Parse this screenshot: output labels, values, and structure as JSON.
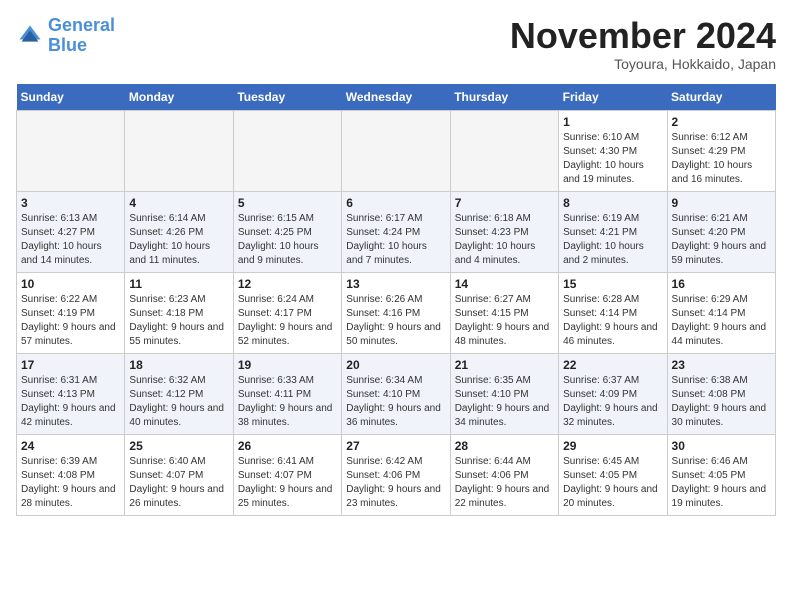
{
  "logo": {
    "line1": "General",
    "line2": "Blue"
  },
  "title": "November 2024",
  "subtitle": "Toyoura, Hokkaido, Japan",
  "weekdays": [
    "Sunday",
    "Monday",
    "Tuesday",
    "Wednesday",
    "Thursday",
    "Friday",
    "Saturday"
  ],
  "weeks": [
    [
      {
        "day": "",
        "info": ""
      },
      {
        "day": "",
        "info": ""
      },
      {
        "day": "",
        "info": ""
      },
      {
        "day": "",
        "info": ""
      },
      {
        "day": "",
        "info": ""
      },
      {
        "day": "1",
        "info": "Sunrise: 6:10 AM\nSunset: 4:30 PM\nDaylight: 10 hours and 19 minutes."
      },
      {
        "day": "2",
        "info": "Sunrise: 6:12 AM\nSunset: 4:29 PM\nDaylight: 10 hours and 16 minutes."
      }
    ],
    [
      {
        "day": "3",
        "info": "Sunrise: 6:13 AM\nSunset: 4:27 PM\nDaylight: 10 hours and 14 minutes."
      },
      {
        "day": "4",
        "info": "Sunrise: 6:14 AM\nSunset: 4:26 PM\nDaylight: 10 hours and 11 minutes."
      },
      {
        "day": "5",
        "info": "Sunrise: 6:15 AM\nSunset: 4:25 PM\nDaylight: 10 hours and 9 minutes."
      },
      {
        "day": "6",
        "info": "Sunrise: 6:17 AM\nSunset: 4:24 PM\nDaylight: 10 hours and 7 minutes."
      },
      {
        "day": "7",
        "info": "Sunrise: 6:18 AM\nSunset: 4:23 PM\nDaylight: 10 hours and 4 minutes."
      },
      {
        "day": "8",
        "info": "Sunrise: 6:19 AM\nSunset: 4:21 PM\nDaylight: 10 hours and 2 minutes."
      },
      {
        "day": "9",
        "info": "Sunrise: 6:21 AM\nSunset: 4:20 PM\nDaylight: 9 hours and 59 minutes."
      }
    ],
    [
      {
        "day": "10",
        "info": "Sunrise: 6:22 AM\nSunset: 4:19 PM\nDaylight: 9 hours and 57 minutes."
      },
      {
        "day": "11",
        "info": "Sunrise: 6:23 AM\nSunset: 4:18 PM\nDaylight: 9 hours and 55 minutes."
      },
      {
        "day": "12",
        "info": "Sunrise: 6:24 AM\nSunset: 4:17 PM\nDaylight: 9 hours and 52 minutes."
      },
      {
        "day": "13",
        "info": "Sunrise: 6:26 AM\nSunset: 4:16 PM\nDaylight: 9 hours and 50 minutes."
      },
      {
        "day": "14",
        "info": "Sunrise: 6:27 AM\nSunset: 4:15 PM\nDaylight: 9 hours and 48 minutes."
      },
      {
        "day": "15",
        "info": "Sunrise: 6:28 AM\nSunset: 4:14 PM\nDaylight: 9 hours and 46 minutes."
      },
      {
        "day": "16",
        "info": "Sunrise: 6:29 AM\nSunset: 4:14 PM\nDaylight: 9 hours and 44 minutes."
      }
    ],
    [
      {
        "day": "17",
        "info": "Sunrise: 6:31 AM\nSunset: 4:13 PM\nDaylight: 9 hours and 42 minutes."
      },
      {
        "day": "18",
        "info": "Sunrise: 6:32 AM\nSunset: 4:12 PM\nDaylight: 9 hours and 40 minutes."
      },
      {
        "day": "19",
        "info": "Sunrise: 6:33 AM\nSunset: 4:11 PM\nDaylight: 9 hours and 38 minutes."
      },
      {
        "day": "20",
        "info": "Sunrise: 6:34 AM\nSunset: 4:10 PM\nDaylight: 9 hours and 36 minutes."
      },
      {
        "day": "21",
        "info": "Sunrise: 6:35 AM\nSunset: 4:10 PM\nDaylight: 9 hours and 34 minutes."
      },
      {
        "day": "22",
        "info": "Sunrise: 6:37 AM\nSunset: 4:09 PM\nDaylight: 9 hours and 32 minutes."
      },
      {
        "day": "23",
        "info": "Sunrise: 6:38 AM\nSunset: 4:08 PM\nDaylight: 9 hours and 30 minutes."
      }
    ],
    [
      {
        "day": "24",
        "info": "Sunrise: 6:39 AM\nSunset: 4:08 PM\nDaylight: 9 hours and 28 minutes."
      },
      {
        "day": "25",
        "info": "Sunrise: 6:40 AM\nSunset: 4:07 PM\nDaylight: 9 hours and 26 minutes."
      },
      {
        "day": "26",
        "info": "Sunrise: 6:41 AM\nSunset: 4:07 PM\nDaylight: 9 hours and 25 minutes."
      },
      {
        "day": "27",
        "info": "Sunrise: 6:42 AM\nSunset: 4:06 PM\nDaylight: 9 hours and 23 minutes."
      },
      {
        "day": "28",
        "info": "Sunrise: 6:44 AM\nSunset: 4:06 PM\nDaylight: 9 hours and 22 minutes."
      },
      {
        "day": "29",
        "info": "Sunrise: 6:45 AM\nSunset: 4:05 PM\nDaylight: 9 hours and 20 minutes."
      },
      {
        "day": "30",
        "info": "Sunrise: 6:46 AM\nSunset: 4:05 PM\nDaylight: 9 hours and 19 minutes."
      }
    ]
  ]
}
